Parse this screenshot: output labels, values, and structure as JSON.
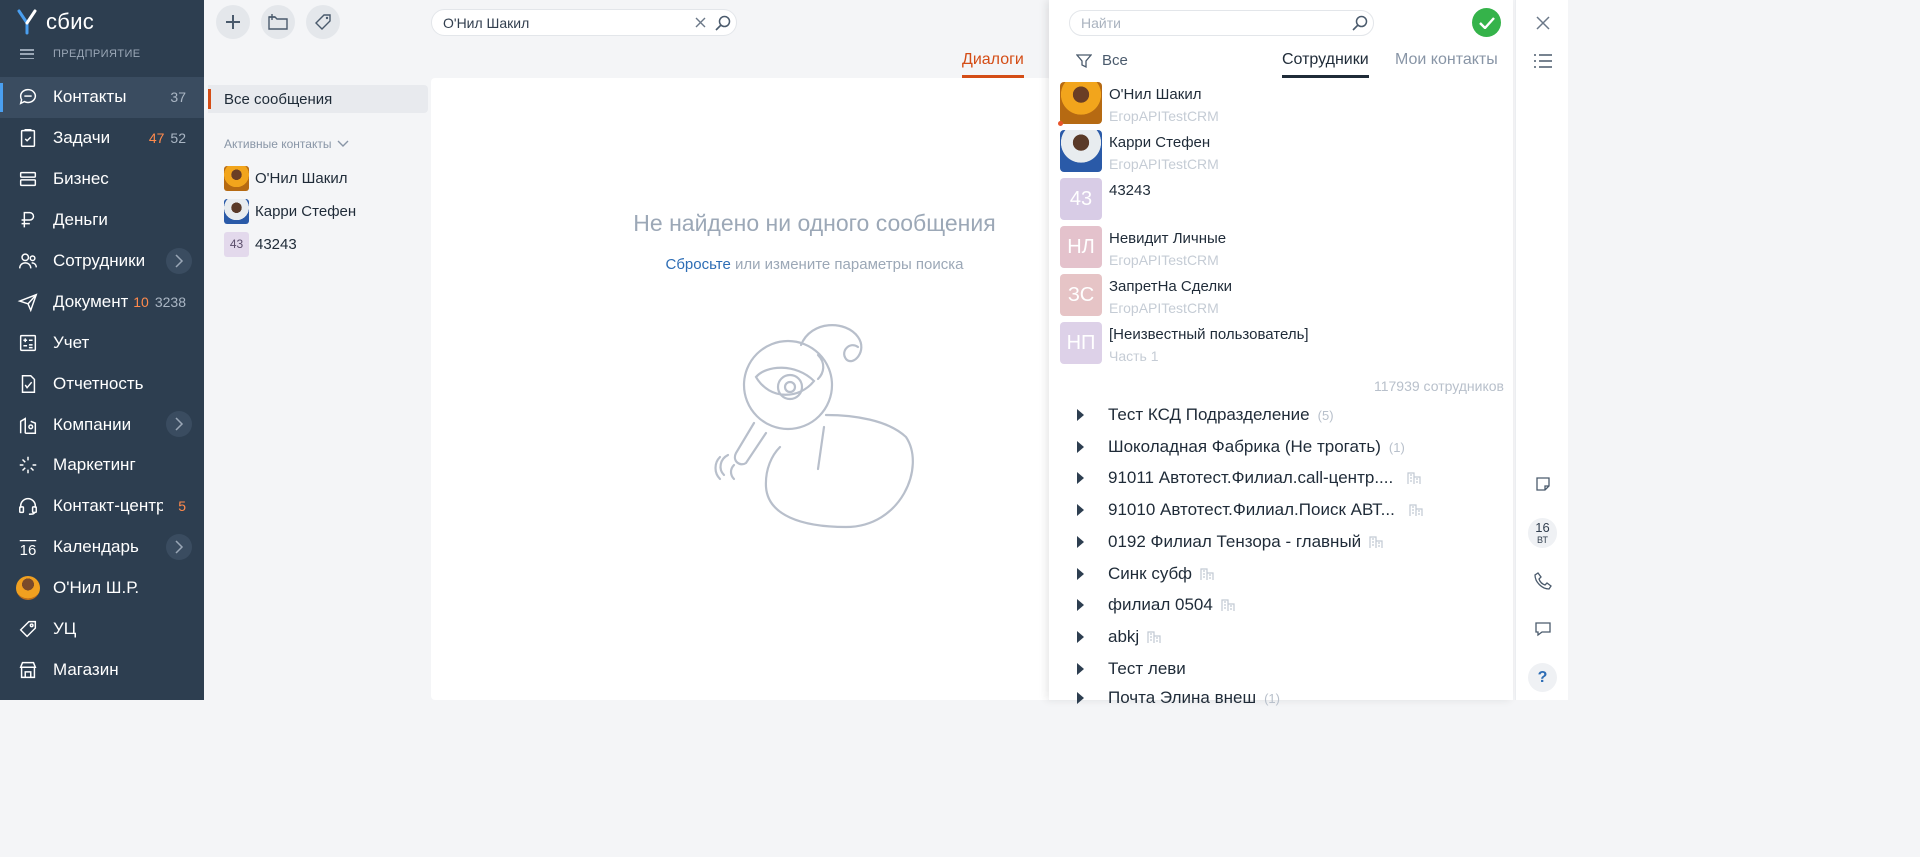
{
  "app": {
    "brand": "сбис",
    "company_label": "ПРЕДПРИЯТИЕ"
  },
  "sidebar": {
    "items": [
      {
        "label": "Контакты",
        "count": "37",
        "icon": "chat-icon",
        "active": true
      },
      {
        "label": "Задачи",
        "count_hot": "47",
        "count": "52",
        "icon": "clipboard-icon"
      },
      {
        "label": "Бизнес",
        "icon": "layers-icon"
      },
      {
        "label": "Деньги",
        "icon": "money-icon"
      },
      {
        "label": "Сотрудники",
        "icon": "people-icon",
        "expand": true
      },
      {
        "label": "Документы",
        "count_hot": "10",
        "count": "3238",
        "icon": "send-icon"
      },
      {
        "label": "Учет",
        "icon": "calculator-icon"
      },
      {
        "label": "Отчетность",
        "icon": "report-icon"
      },
      {
        "label": "Компании",
        "icon": "location-icon",
        "expand": true
      },
      {
        "label": "Маркетинг",
        "icon": "cursor-icon"
      },
      {
        "label": "Контакт-центр",
        "count_hot": "5",
        "icon": "headset-icon"
      },
      {
        "label": "Календарь",
        "icon": "calendar-icon",
        "calendar_day": "16",
        "expand": true
      },
      {
        "label": "О'Нил Ш.Р.",
        "icon": "user-avatar"
      },
      {
        "label": "УЦ",
        "icon": "tag-icon"
      },
      {
        "label": "Магазин",
        "icon": "store-icon"
      }
    ]
  },
  "toolbar": {
    "search_value": "О'Нил Шакил"
  },
  "tabs": {
    "dialogs": "Диалоги"
  },
  "filter": {
    "all_messages": "Все сообщения",
    "active_contacts": "Активные контакты",
    "contacts": [
      {
        "name": "О'Нил Шакил",
        "avatar": "photo"
      },
      {
        "name": "Карри Стефен",
        "avatar": "photo"
      },
      {
        "name": "43243",
        "avatar": "43"
      }
    ]
  },
  "empty": {
    "title": "Не найдено ни одного сообщения",
    "reset_link": "Сбросьте",
    "sub_rest": " или измените параметры поиска"
  },
  "panel": {
    "search_placeholder": "Найти",
    "filter_all": "Все",
    "tab_employees": "Сотрудники",
    "tab_contacts": "Мои контакты",
    "employees": [
      {
        "name": "О'Нил Шакил",
        "sub": "ЕгорAPITestCRM",
        "avatar": "photo1"
      },
      {
        "name": "Карри Стефен",
        "sub": "ЕгорAPITestCRM",
        "avatar": "photo2"
      },
      {
        "name": "43243",
        "sub": "",
        "initials": "43",
        "color": "#d8cce6"
      },
      {
        "name": "Невидит Личные",
        "sub": "ЕгорAPITestCRM",
        "initials": "НЛ",
        "color": "#e4c2cc"
      },
      {
        "name": "ЗапретНа Сделки",
        "sub": "ЕгорAPITestCRM",
        "initials": "ЗС",
        "color": "#e6c4c6"
      },
      {
        "name": "[Неизвестный пользователь]",
        "sub": "Часть 1",
        "initials": "НП",
        "color": "#ddd1e8"
      }
    ],
    "total": "117939 сотрудников",
    "departments": [
      {
        "name": "Тест КСД Подразделение",
        "count": "(5)"
      },
      {
        "name": "Шоколадная Фабрика (Не трогать)",
        "count": "(1)"
      },
      {
        "name": "91011 Автотест.Филиал.call-центр....",
        "branch": true
      },
      {
        "name": "91010 Автотест.Филиал.Поиск АВТ...",
        "branch": true
      },
      {
        "name": "0192 Филиал Тензора - главный",
        "branch": true
      },
      {
        "name": "Синк субф",
        "branch": true
      },
      {
        "name": "филиал 0504",
        "branch": true
      },
      {
        "name": "abkj",
        "branch": true
      },
      {
        "name": "Тест леви"
      },
      {
        "name": "Почта Элина внеш",
        "count": "(1)"
      }
    ]
  },
  "rail": {
    "date_day": "16",
    "date_weekday": "ВТ",
    "help": "?"
  },
  "colors": {
    "sidebar": "#2d3e50",
    "accent": "#d44d16",
    "ok": "#35b34a",
    "link": "#2d6db5"
  }
}
